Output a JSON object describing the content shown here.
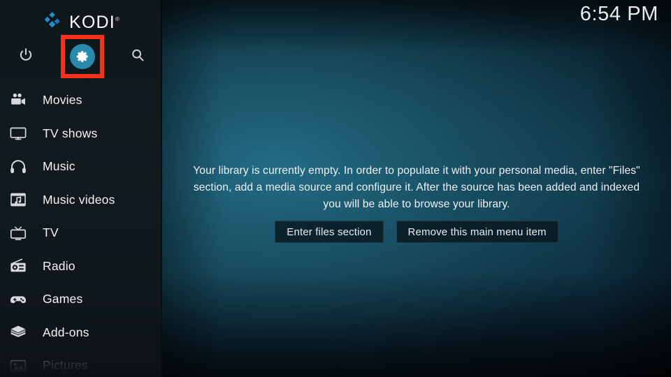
{
  "app": {
    "name": "KODI",
    "trademark": "®"
  },
  "header": {
    "clock": "6:54 PM",
    "icons": [
      {
        "name": "power-icon",
        "label": "Power"
      },
      {
        "name": "settings-gear-icon",
        "label": "Settings"
      },
      {
        "name": "search-icon",
        "label": "Search"
      }
    ]
  },
  "sidebar": {
    "items": [
      {
        "label": "Movies",
        "icon": "movie-camera-icon",
        "dim": false
      },
      {
        "label": "TV shows",
        "icon": "television-icon",
        "dim": false
      },
      {
        "label": "Music",
        "icon": "headphones-icon",
        "dim": false
      },
      {
        "label": "Music videos",
        "icon": "film-music-icon",
        "dim": false
      },
      {
        "label": "TV",
        "icon": "tv-antenna-icon",
        "dim": false
      },
      {
        "label": "Radio",
        "icon": "radio-icon",
        "dim": false
      },
      {
        "label": "Games",
        "icon": "gamepad-icon",
        "dim": false
      },
      {
        "label": "Add-ons",
        "icon": "package-box-icon",
        "dim": false
      },
      {
        "label": "Pictures",
        "icon": "picture-frame-icon",
        "dim": true
      }
    ]
  },
  "main": {
    "empty_message": "Your library is currently empty. In order to populate it with your personal media, enter \"Files\" section, add a media source and configure it. After the source has been added and indexed you will be able to browse your library.",
    "buttons": [
      {
        "label": "Enter files section"
      },
      {
        "label": "Remove this main menu item"
      }
    ]
  },
  "annotation": {
    "highlight_color": "#f9311c",
    "target": "settings-gear-icon"
  },
  "colors": {
    "accent_blue": "#2b89ab",
    "logo_blue": "#1f8fd0",
    "sidebar_bg": "#10171b",
    "highlight_red": "#f9311c"
  }
}
